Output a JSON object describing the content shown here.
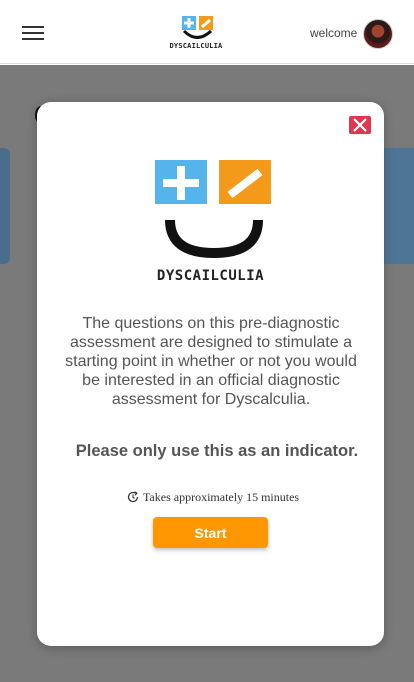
{
  "header": {
    "brand": "DYSCAILCULIA",
    "welcome": "welcome"
  },
  "modal": {
    "brand": "DYSCAILCULIA",
    "description": "The questions on this pre-diagnostic assessment are designed to stimulate a starting point in whether or not you would be interested in an official diagnostic assessment for Dyscalculia.",
    "indicator": "Please only use this as an indicator.",
    "time_text": "Takes approximately 15 minutes",
    "start_label": "Start"
  },
  "colors": {
    "accent": "#ff9800",
    "plus_tile": "#56b4ec",
    "minus_tile": "#f39a1a",
    "close": "#e0364f",
    "backdrop": "#7a7a7a"
  },
  "icons": [
    "menu-icon",
    "close-icon",
    "refresh-clock-icon"
  ]
}
